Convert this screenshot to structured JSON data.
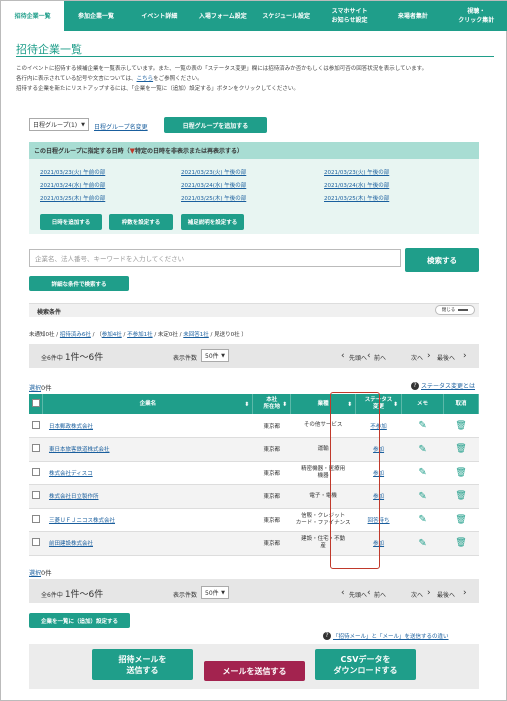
{
  "tabs": [
    "招待企業一覧",
    "参加企業一覧",
    "イベント詳細",
    "入場フォーム設定",
    "スケジュール設定",
    "スマホサイト\nお知らせ設定",
    "来場者集計",
    "視聴・\nクリック集計"
  ],
  "title": "招待企業一覧",
  "desc1": "このイベントに招待する候補企業を一覧表示しています。また、一覧の表の「ステータス変更」欄には招待済みか否かもしくは参加可否の回答状況を表示しています。",
  "desc2a": "各行内に表示されている記号や文言については、",
  "desc2link": "こちら",
  "desc2b": "をご参照ください。",
  "desc3": "招待する企業を新たにリストアップするには、「企業を一覧に（追加）設定する」ボタンをクリックしてください。",
  "group_select": "日程グループ(1)",
  "group_rename": "日程グループ名変更",
  "group_add": "日程グループを追加する",
  "sched_head_a": "この日程グループに指定する日時（",
  "sched_head_b": "特定の日時を非表示または再表示する）",
  "dates": [
    [
      "2021/03/23(火) 午前の部",
      "2021/03/23(火) 午後の部",
      "2021/03/23(火) 午後の部"
    ],
    [
      "2021/03/24(水) 午前の部",
      "2021/03/24(水) 午後の部",
      "2021/03/24(水) 午後の部"
    ],
    [
      "2021/03/25(木) 午前の部",
      "2021/03/25(木) 午後の部",
      "2021/03/25(木) 午後の部"
    ]
  ],
  "btn_add_date": "日時を追加する",
  "btn_slots": "枠数を設定する",
  "btn_note": "補足説明を設定する",
  "search_placeholder": "企業名、法人番号、キーワードを入力してください",
  "search_btn": "検索する",
  "adv_search": "詳細な条件で検索する",
  "cond_label": "検索条件",
  "cond_toggle": "閉じる",
  "status_pre": "未通知0社 / ",
  "status_links": [
    "招待済み6社",
    "参加4社",
    "不参加1社"
  ],
  "status_mid": " / 未定0社 / ",
  "status_link4": "未回答1社",
  "status_post": " / 見送り0社 ）",
  "count_text": "全6件中",
  "count_range": "1件～6件",
  "per_page_label": "表示件数",
  "per_page": "50件",
  "nav_first": "先頭へ",
  "nav_prev": "前へ",
  "nav_next": "次へ",
  "nav_last": "最後へ",
  "selected_label": "選択",
  "selected_count": "0件",
  "help_status": "ステータス変更とは",
  "headers": [
    "企業名",
    "本社\n所在地",
    "業種",
    "ステータス\n変更",
    "メモ",
    "取消"
  ],
  "rows": [
    {
      "name": "日本郵政株式会社",
      "loc": "東京都",
      "ind": "その他サービス",
      "status": "不参加"
    },
    {
      "name": "東日本旅客鉄道株式会社",
      "loc": "東京都",
      "ind": "運輸",
      "status": "参加"
    },
    {
      "name": "株式会社ディスコ",
      "loc": "東京都",
      "ind": "精密機器・医療用\n機器",
      "status": "参加"
    },
    {
      "name": "株式会社日立製作所",
      "loc": "東京都",
      "ind": "電子・電機",
      "status": "参加"
    },
    {
      "name": "三菱ＵＦＪニコス株式会社",
      "loc": "東京都",
      "ind": "信販・クレジット\nカード・ファイナンス",
      "status": "回答待ち"
    },
    {
      "name": "前田建設株式会社",
      "loc": "東京都",
      "ind": "建設・住宅・不動\n産",
      "status": "参加"
    }
  ],
  "add_btn": "企業を一覧に（追加）設定する",
  "mail_help": "「招待メール」と「メール」を送信するの違い",
  "btn_invite": "招待メールを\n送信する",
  "btn_mail": "メールを送信する",
  "btn_csv": "CSVデータを\nダウンロードする"
}
